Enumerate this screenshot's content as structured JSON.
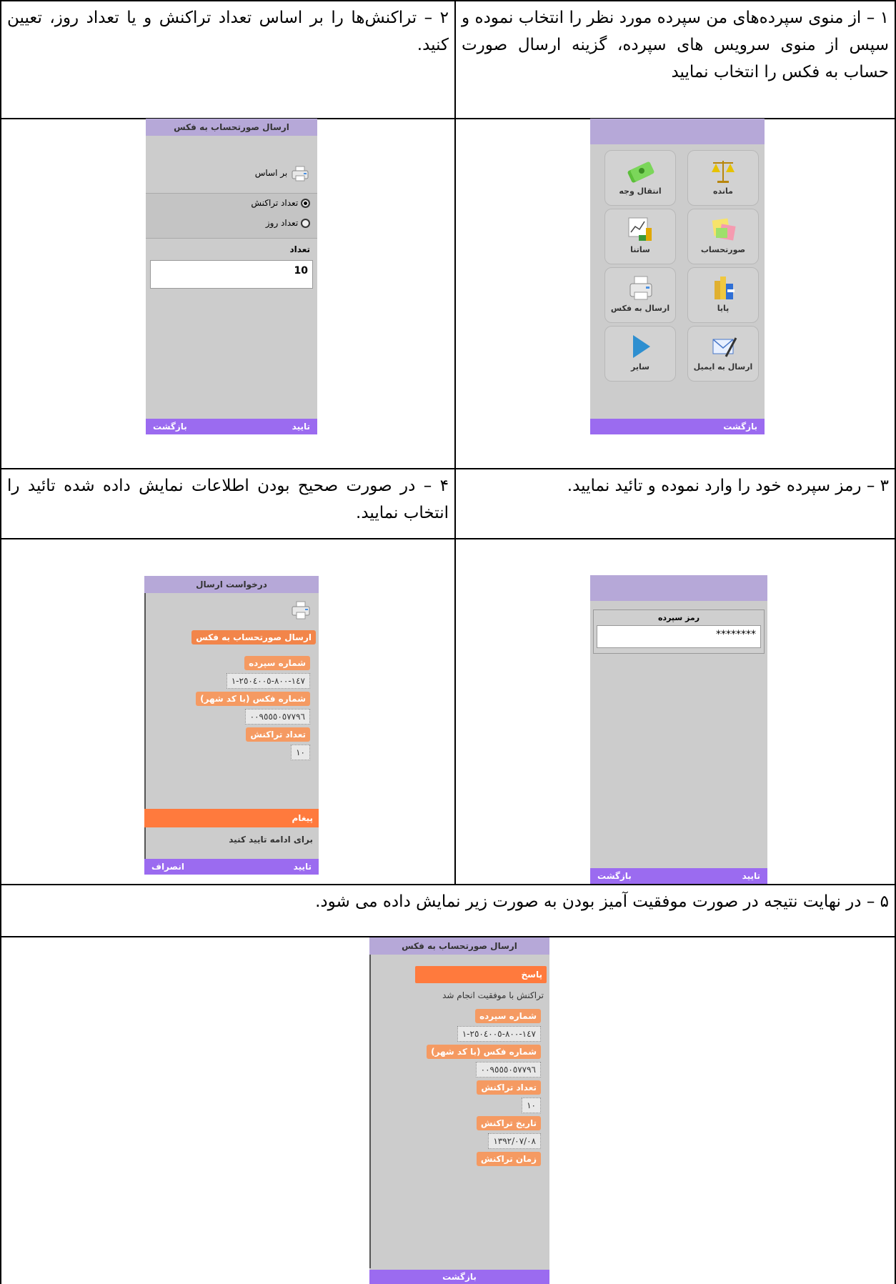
{
  "steps": {
    "s1": "١ – از منوی سپرده‌های من سپرده مورد نظر را انتخاب نموده و سپس از منوی سرویس های سپرده، گزینه ارسال صورت حساب به فکس  را انتخاب نمایید",
    "s2": "٢ – تراکنش‌ها را بر اساس تعداد تراکنش و یا تعداد روز، تعیین کنید.",
    "s3": "٣ – رمز سپرده خود را وارد نموده و تائید نمایید.",
    "s4": "۴ – در صورت صحیح بودن اطلاعات نمایش داده شده تائید را انتخاب نمایید.",
    "s5": "۵ – در نهایت نتیجه در صورت موفقیت آمیز بودن به صورت زیر نمایش داده می شود."
  },
  "menu_screen": {
    "tiles": [
      {
        "label": "مانده",
        "icon": "scale-icon"
      },
      {
        "label": "انتقال وجه",
        "icon": "money-icon"
      },
      {
        "label": "صورتحساب",
        "icon": "notes-icon"
      },
      {
        "label": "ساتنا",
        "icon": "chart-icon"
      },
      {
        "label": "پایا",
        "icon": "coins-icon"
      },
      {
        "label": "ارسال به فکس",
        "icon": "fax-icon"
      },
      {
        "label": "ارسال به ایمیل",
        "icon": "email-icon"
      },
      {
        "label": "سایر",
        "icon": "play-icon"
      }
    ],
    "footer_back": "بازگشت"
  },
  "fax_form_screen": {
    "title": "ارسال صورتحساب به فکس",
    "basis_label": "بر اساس",
    "option_transactions": "تعداد تراکنش",
    "option_days": "تعداد روز",
    "count_label": "تعداد",
    "count_value": "10",
    "footer_confirm": "تایید",
    "footer_back": "بازگشت"
  },
  "password_screen": {
    "label": "رمز سپرده",
    "value": "********",
    "footer_confirm": "تایید",
    "footer_back": "بازگشت"
  },
  "confirm_screen": {
    "title": "درخواست ارسال",
    "heading": "ارسال صورتحساب به فکس",
    "account_label": "شماره سپرده",
    "account_value": "١٤٧-٨٠٠-٢٥٠٤٠٠٥-١",
    "fax_label": "شماره فکس (با کد شهر)",
    "fax_value": "٠٠٩٥٥٥٠٥٧٧٩٦",
    "count_label": "تعداد تراکنش",
    "count_value": "١٠",
    "message_label": "پیغام",
    "message_text": "برای ادامه تایید کنید",
    "footer_confirm": "تایید",
    "footer_cancel": "انصراف"
  },
  "result_screen": {
    "title": "ارسال صورتحساب به فکس",
    "response_label": "پاسخ",
    "response_text": "تراکنش با موفقیت انجام شد",
    "account_label": "شماره سپرده",
    "account_value": "١٤٧-٨٠٠-٢٥٠٤٠٠٥-١",
    "fax_label": "شماره فکس (با کد شهر)",
    "fax_value": "٠٠٩٥٥٥٠٥٧٧٩٦",
    "count_label": "تعداد تراکنش",
    "count_value": "١٠",
    "date_label": "تاریخ تراکنش",
    "date_value": "١٣٩٢/٠٧/٠٨",
    "time_label": "زمان تراکنش",
    "footer_back": "بازگشت"
  }
}
